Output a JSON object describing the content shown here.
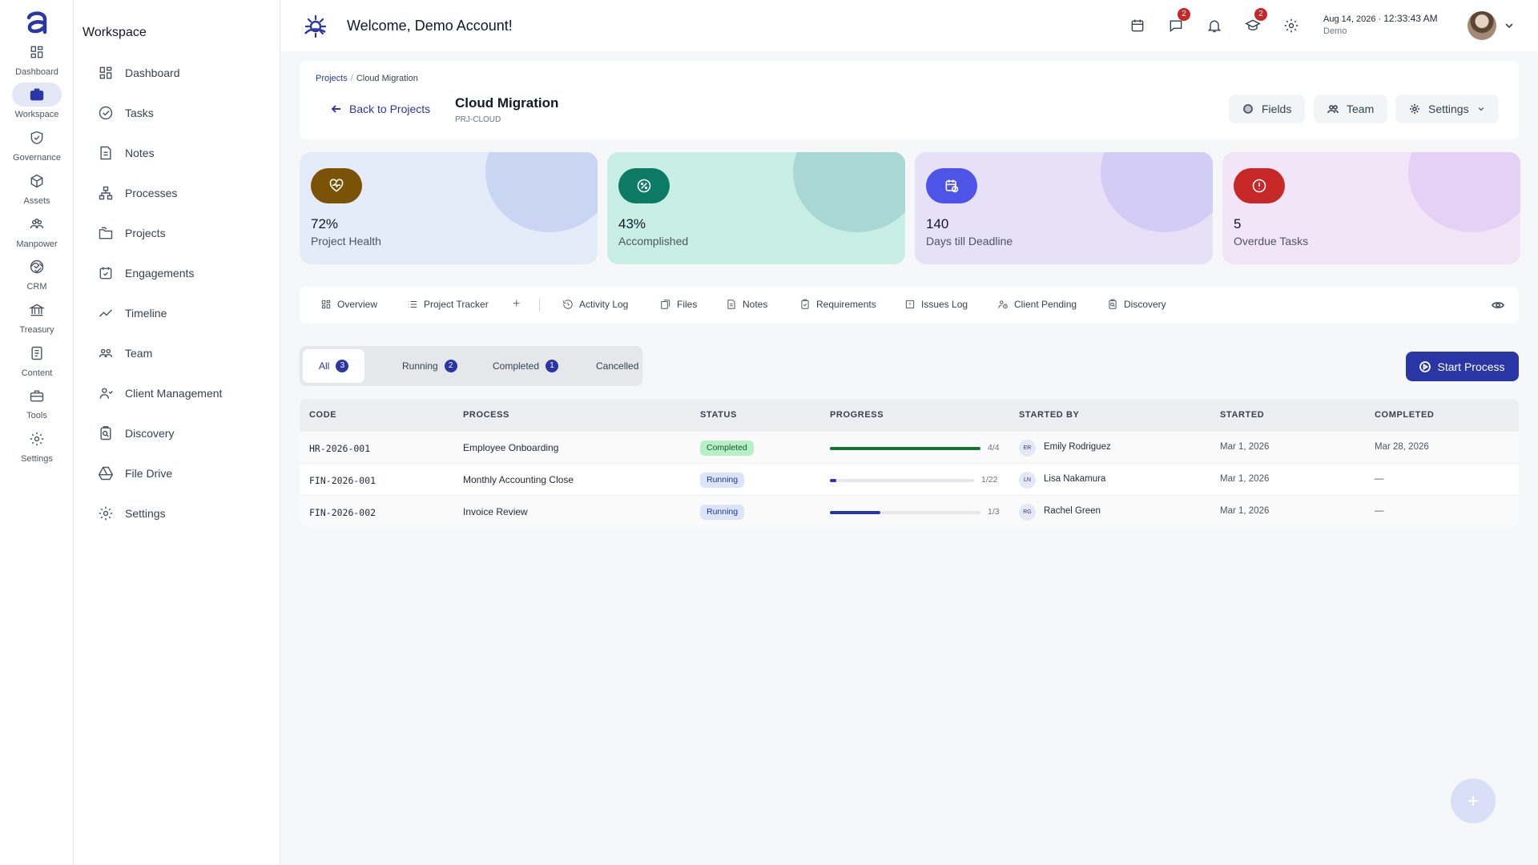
{
  "header": {
    "welcome": "Welcome, Demo Account!",
    "messages_badge": "2",
    "learning_badge": "2",
    "date": "Aug 14, 2026",
    "time": "12:33:43 AM",
    "user": "Demo"
  },
  "rail": [
    {
      "label": "Dashboard",
      "icon": "grid-icon"
    },
    {
      "label": "Workspace",
      "icon": "briefcase-icon"
    },
    {
      "label": "Governance",
      "icon": "shield-icon"
    },
    {
      "label": "Assets",
      "icon": "cube-icon"
    },
    {
      "label": "Manpower",
      "icon": "users-icon"
    },
    {
      "label": "CRM",
      "icon": "handshake-icon"
    },
    {
      "label": "Treasury",
      "icon": "bank-icon"
    },
    {
      "label": "Content",
      "icon": "document-icon"
    },
    {
      "label": "Tools",
      "icon": "toolbox-icon"
    },
    {
      "label": "Settings",
      "icon": "gear-icon"
    }
  ],
  "sidebar": {
    "title": "Workspace",
    "items": [
      {
        "label": "Dashboard",
        "icon": "grid-icon"
      },
      {
        "label": "Tasks",
        "icon": "check-circle-icon"
      },
      {
        "label": "Notes",
        "icon": "note-icon"
      },
      {
        "label": "Processes",
        "icon": "hierarchy-icon"
      },
      {
        "label": "Projects",
        "icon": "folders-icon"
      },
      {
        "label": "Engagements",
        "icon": "calendar-check-icon"
      },
      {
        "label": "Timeline",
        "icon": "trend-icon"
      },
      {
        "label": "Team",
        "icon": "team-icon"
      },
      {
        "label": "Client Management",
        "icon": "client-icon"
      },
      {
        "label": "Discovery",
        "icon": "discovery-icon"
      },
      {
        "label": "File Drive",
        "icon": "drive-icon"
      },
      {
        "label": "Settings",
        "icon": "gear-icon"
      }
    ]
  },
  "project": {
    "crumb_root": "Projects",
    "crumb_sep": "/",
    "crumb_current": "Cloud Migration",
    "back_label": "Back to Projects",
    "name": "Cloud Migration",
    "code": "PRJ-CLOUD",
    "buttons": {
      "fields": "Fields",
      "team": "Team",
      "settings": "Settings"
    }
  },
  "stats": [
    {
      "value": "72%",
      "label": "Project Health",
      "color": "#7a5306",
      "bg": "#e3ecf8",
      "deco": "#c9d5f2"
    },
    {
      "value": "43%",
      "label": "Accomplished",
      "color": "#0d7a66",
      "bg": "#c9eee5",
      "deco": "#a9d7d4"
    },
    {
      "value": "140",
      "label": "Days till Deadline",
      "color": "#4f54e8",
      "bg": "#e7e1f7",
      "deco": "#d3cdf6"
    },
    {
      "value": "5",
      "label": "Overdue Tasks",
      "color": "#c62828",
      "bg": "#f3e5f8",
      "deco": "#e5d1f5"
    }
  ],
  "tabs": [
    {
      "label": "Overview",
      "icon": "grid-icon"
    },
    {
      "label": "Project Tracker",
      "icon": "list-icon"
    },
    {
      "label": "Activity Log",
      "icon": "history-icon"
    },
    {
      "label": "Files",
      "icon": "files-icon"
    },
    {
      "label": "Notes",
      "icon": "note-icon"
    },
    {
      "label": "Requirements",
      "icon": "clipboard-check-icon"
    },
    {
      "label": "Issues Log",
      "icon": "issue-icon"
    },
    {
      "label": "Client Pending",
      "icon": "client-pending-icon"
    },
    {
      "label": "Discovery",
      "icon": "discovery-icon"
    }
  ],
  "tab_add": "+",
  "filters": [
    {
      "label": "All",
      "count": "3"
    },
    {
      "label": "Running",
      "count": "2"
    },
    {
      "label": "Completed",
      "count": "1"
    },
    {
      "label": "Cancelled"
    }
  ],
  "start_process": "Start Process",
  "table": {
    "columns": [
      "CODE",
      "PROCESS",
      "STATUS",
      "PROGRESS",
      "STARTED BY",
      "STARTED",
      "COMPLETED"
    ],
    "rows": [
      {
        "code": "HR-2026-001",
        "process": "Employee Onboarding",
        "status": "Completed",
        "progress_done": 4,
        "progress_total": 4,
        "progress_text": "4/4",
        "initials": "ER",
        "started_by": "Emily Rodriguez",
        "started": "Mar 1, 2026",
        "completed": "Mar 28, 2026"
      },
      {
        "code": "FIN-2026-001",
        "process": "Monthly Accounting Close",
        "status": "Running",
        "progress_done": 1,
        "progress_total": 22,
        "progress_text": "1/22",
        "initials": "LN",
        "started_by": "Lisa Nakamura",
        "started": "Mar 1, 2026",
        "completed": "—"
      },
      {
        "code": "FIN-2026-002",
        "process": "Invoice Review",
        "status": "Running",
        "progress_done": 1,
        "progress_total": 3,
        "progress_text": "1/3",
        "initials": "RG",
        "started_by": "Rachel Green",
        "started": "Mar 1, 2026",
        "completed": "—"
      }
    ]
  },
  "colors": {
    "accent": "#2b36a6",
    "completed_bar": "#15703a",
    "running_bar": "#2b36a6"
  }
}
